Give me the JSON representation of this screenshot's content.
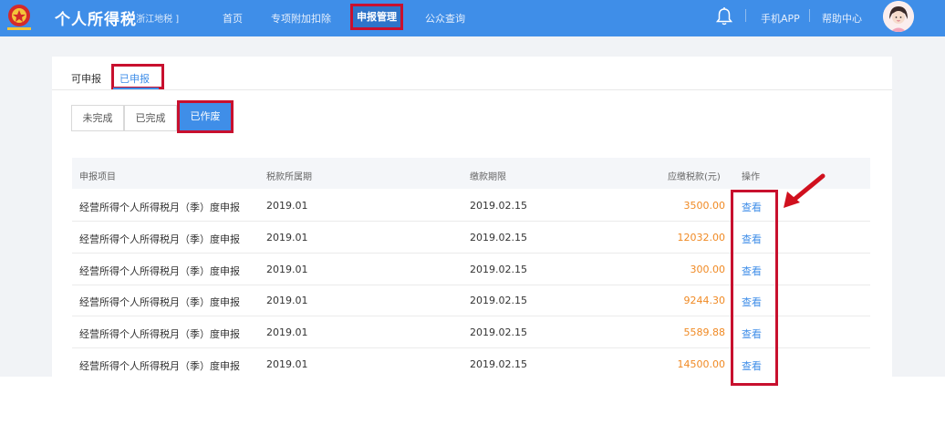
{
  "header": {
    "title": "个人所得税",
    "region": "[ 浙江地税 ]",
    "nav": [
      "首页",
      "专项附加扣除",
      "申报管理",
      "公众查询"
    ],
    "active_nav": "申报管理",
    "right_links": [
      "手机APP",
      "帮助中心"
    ]
  },
  "tabs": {
    "items": [
      "可申报",
      "已申报"
    ],
    "active": "已申报"
  },
  "filters": {
    "items": [
      "未完成",
      "已完成"
    ],
    "active": "已作废"
  },
  "table": {
    "columns": [
      "申报项目",
      "税款所属期",
      "缴款期限",
      "应缴税款(元)",
      "操作"
    ],
    "rows": [
      {
        "item": "经营所得个人所得税月（季）度申报",
        "period": "2019.01",
        "deadline": "2019.02.15",
        "amount": "3500.00",
        "action": "查看"
      },
      {
        "item": "经营所得个人所得税月（季）度申报",
        "period": "2019.01",
        "deadline": "2019.02.15",
        "amount": "12032.00",
        "action": "查看"
      },
      {
        "item": "经营所得个人所得税月（季）度申报",
        "period": "2019.01",
        "deadline": "2019.02.15",
        "amount": "300.00",
        "action": "查看"
      },
      {
        "item": "经营所得个人所得税月（季）度申报",
        "period": "2019.01",
        "deadline": "2019.02.15",
        "amount": "9244.30",
        "action": "查看"
      },
      {
        "item": "经营所得个人所得税月（季）度申报",
        "period": "2019.01",
        "deadline": "2019.02.15",
        "amount": "5589.88",
        "action": "查看"
      },
      {
        "item": "经营所得个人所得税月（季）度申报",
        "period": "2019.01",
        "deadline": "2019.02.15",
        "amount": "14500.00",
        "action": "查看"
      }
    ]
  },
  "colors": {
    "primary": "#3f8ee8",
    "highlight": "#c8102e",
    "amount": "#f08a24"
  },
  "icons": [
    "tax-emblem-icon",
    "bell-icon",
    "avatar-icon",
    "arrow-annotation-icon"
  ]
}
